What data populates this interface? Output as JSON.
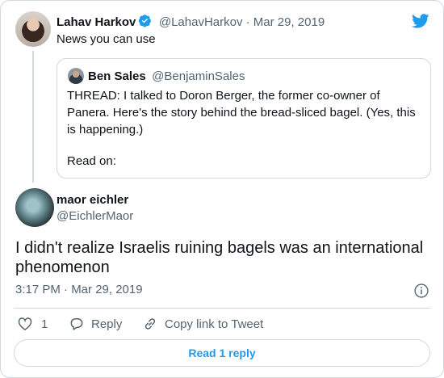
{
  "parent_tweet": {
    "author_name": "Lahav Harkov",
    "handle_date": "@LahavHarkov · Mar 29, 2019",
    "text": "News you can use"
  },
  "quoted_tweet": {
    "author_name": "Ben Sales",
    "handle": "@BenjaminSales",
    "text_line1": "THREAD: I talked to Doron Berger, the former co-owner of",
    "text_line2": "Panera. Here's the story behind the bread-sliced bagel. (Yes, this",
    "text_line3": "is happening.)",
    "text_line4": "Read on:"
  },
  "main_tweet": {
    "author_name": "maor eichler",
    "handle": "@EichlerMaor",
    "text": "I didn't realize Israelis ruining bagels was an international phenomenon",
    "timestamp": "3:17 PM · Mar 29, 2019"
  },
  "actions": {
    "like_count": "1",
    "reply_label": "Reply",
    "copy_label": "Copy link to Tweet"
  },
  "read_replies_label": "Read 1 reply",
  "colors": {
    "accent": "#1d9bf0",
    "muted": "#536471",
    "border": "#cfd9de"
  },
  "icons": [
    "verified-icon",
    "twitter-bird-icon",
    "info-icon",
    "heart-icon",
    "reply-icon",
    "link-icon"
  ]
}
